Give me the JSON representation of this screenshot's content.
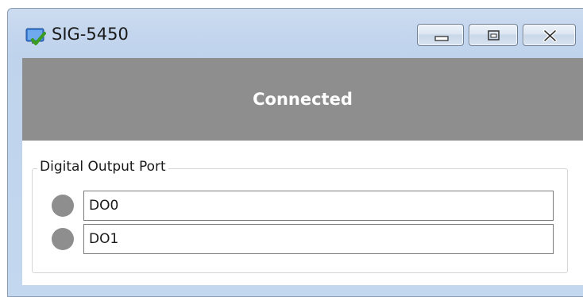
{
  "window": {
    "title": "SIG-5450",
    "icon": "app-checkmark-icon",
    "controls": {
      "minimize": "minimize-icon",
      "maximize": "restore-icon",
      "close": "close-icon"
    }
  },
  "status": {
    "text": "Connected",
    "background_color": "#8e8e8e",
    "text_color": "#ffffff"
  },
  "digital_output": {
    "group_title": "Digital Output Port",
    "ports": [
      {
        "label": "DO0",
        "led_color": "#8e8e8e"
      },
      {
        "label": "DO1",
        "led_color": "#8e8e8e"
      }
    ]
  }
}
